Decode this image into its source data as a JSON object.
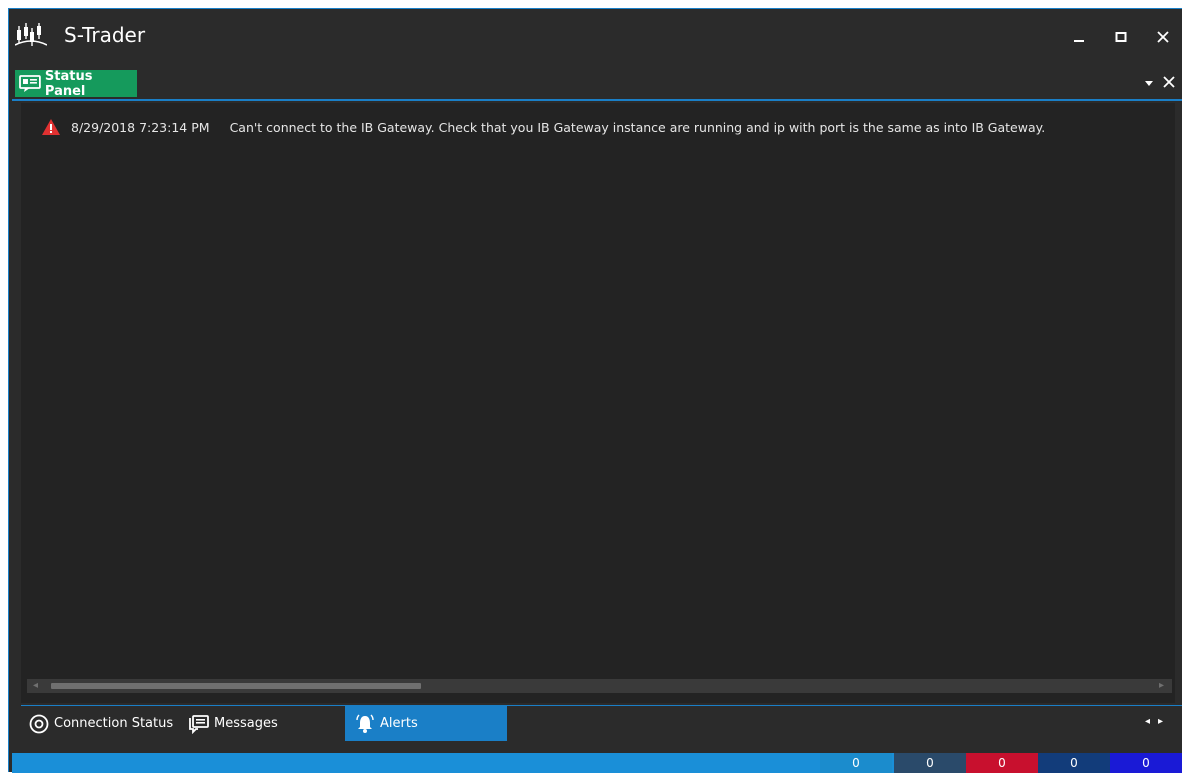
{
  "window": {
    "title": "S-Trader",
    "logo_icon": "candlestick-logo-icon",
    "controls": [
      "minimize-icon",
      "maximize-icon",
      "close-icon"
    ]
  },
  "panel": {
    "tab_label": "Status Panel",
    "tab_icon": "status-panel-icon",
    "accent_color": "#159a5c"
  },
  "log": {
    "entries": [
      {
        "level_icon": "warning-icon",
        "time": "8/29/2018 7:23:14 PM",
        "message": "Can't connect to the IB Gateway. Check that you IB Gateway instance are running and ip with port is the same as into IB Gateway."
      }
    ]
  },
  "bottom_tabs": [
    {
      "label": "Connection Status",
      "icon": "connection-status-icon",
      "active": false
    },
    {
      "label": "Messages",
      "icon": "messages-icon",
      "active": false
    },
    {
      "label": "Alerts",
      "icon": "alerts-bell-icon",
      "active": true
    }
  ],
  "status_counters": [
    {
      "value": "0",
      "color": "#1b8ccd"
    },
    {
      "value": "0",
      "color": "#2a4a6a"
    },
    {
      "value": "0",
      "color": "#c8102e"
    },
    {
      "value": "0",
      "color": "#123c7a"
    },
    {
      "value": "0",
      "color": "#1a1ad6"
    }
  ],
  "colors": {
    "accent_blue": "#1a7fc7",
    "background": "#2b2b2b",
    "content_background": "#232323"
  }
}
